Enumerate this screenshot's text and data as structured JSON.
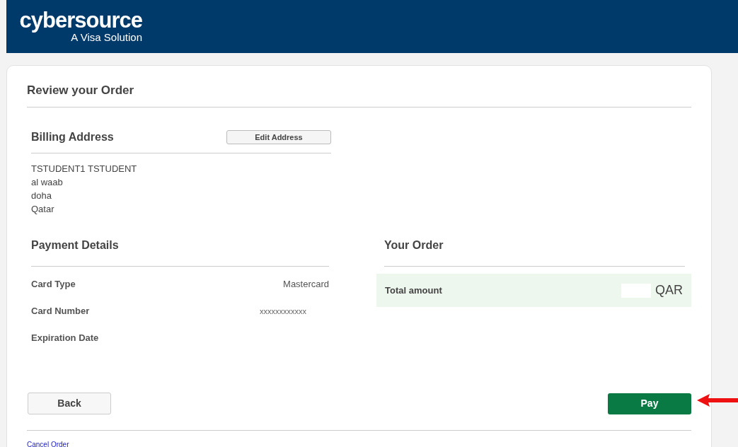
{
  "header": {
    "logo": "cybersource",
    "tagline": "A Visa Solution"
  },
  "title": "Review your Order",
  "billing": {
    "heading": "Billing Address",
    "edit_button": "Edit Address",
    "lines": [
      "TSTUDENT1 TSTUDENT",
      "al waab",
      "doha",
      "Qatar"
    ]
  },
  "payment": {
    "heading": "Payment Details",
    "rows": [
      {
        "label": "Card Type",
        "value": "Mastercard",
        "kind": "plain"
      },
      {
        "label": "Card Number",
        "value": "xxxxxxxxxxxx",
        "kind": "masked"
      },
      {
        "label": "Expiration Date"
      }
    ]
  },
  "order": {
    "heading": "Your Order",
    "total_label": "Total amount",
    "currency": "QAR"
  },
  "buttons": {
    "back": "Back",
    "pay": "Pay"
  },
  "cancel_link": "Cancel Order"
}
